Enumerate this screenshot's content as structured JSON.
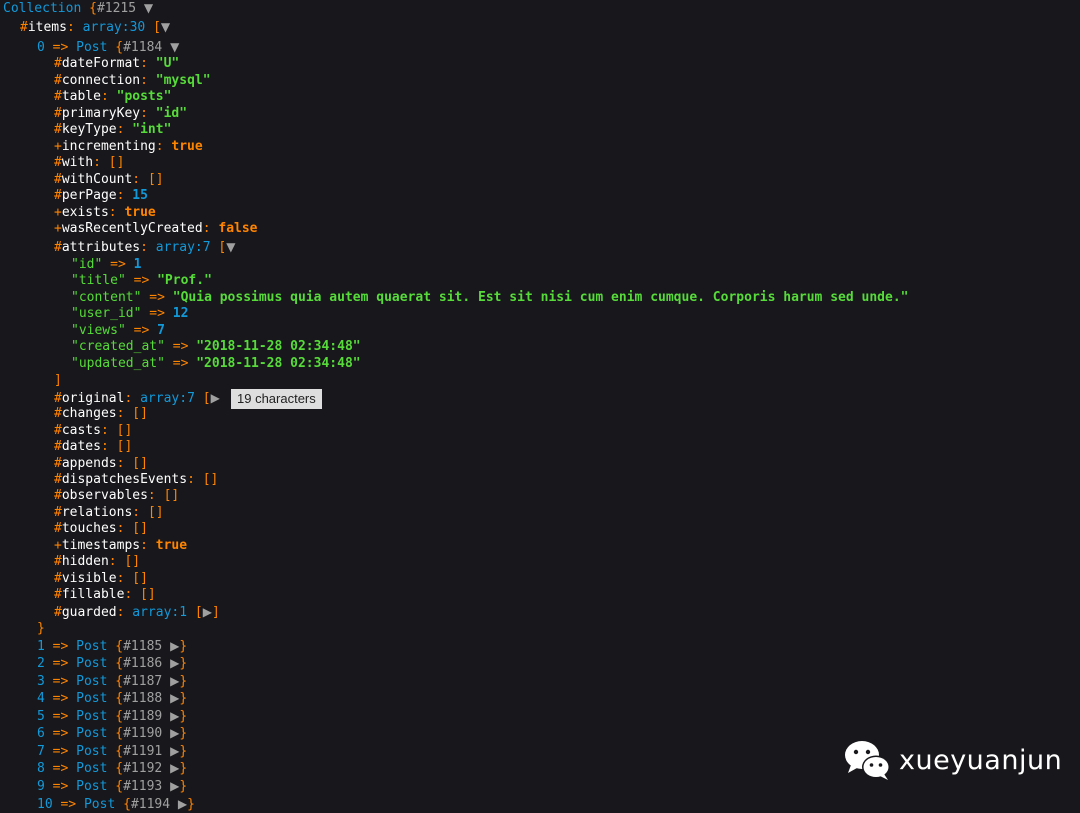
{
  "header": {
    "class_name": "Collection",
    "object_id": "{#1215",
    "collapse_glyph": "▼"
  },
  "items_line": {
    "name": "#items",
    "sep": ":",
    "type": "array:30",
    "bracket": "["
  },
  "post0": {
    "index": "0",
    "arrow": "=>",
    "class_name": "Post",
    "object_id": "{#1184"
  },
  "post0_props": [
    {
      "prefix": "#",
      "name": "dateFormat",
      "value": "\"U\"",
      "kind": "string"
    },
    {
      "prefix": "#",
      "name": "connection",
      "value": "\"mysql\"",
      "kind": "string"
    },
    {
      "prefix": "#",
      "name": "table",
      "value": "\"posts\"",
      "kind": "string"
    },
    {
      "prefix": "#",
      "name": "primaryKey",
      "value": "\"id\"",
      "kind": "string"
    },
    {
      "prefix": "#",
      "name": "keyType",
      "value": "\"int\"",
      "kind": "string"
    },
    {
      "prefix": "+",
      "name": "incrementing",
      "value": "true",
      "kind": "bool"
    },
    {
      "prefix": "#",
      "name": "with",
      "value": "[]",
      "kind": "bracket"
    },
    {
      "prefix": "#",
      "name": "withCount",
      "value": "[]",
      "kind": "bracket"
    },
    {
      "prefix": "#",
      "name": "perPage",
      "value": "15",
      "kind": "number"
    },
    {
      "prefix": "+",
      "name": "exists",
      "value": "true",
      "kind": "bool"
    },
    {
      "prefix": "+",
      "name": "wasRecentlyCreated",
      "value": "false",
      "kind": "bool"
    }
  ],
  "attributes": {
    "name": "#attributes",
    "type": "array:7",
    "bracket": "[",
    "close": "]",
    "entries": [
      {
        "key": "\"id\"",
        "value": "1",
        "kind": "number"
      },
      {
        "key": "\"title\"",
        "value": "\"Prof.\"",
        "kind": "string"
      },
      {
        "key": "\"content\"",
        "value": "\"Quia possimus quia autem quaerat sit. Est sit nisi cum enim cumque. Corporis harum sed unde.\"",
        "kind": "string"
      },
      {
        "key": "\"user_id\"",
        "value": "12",
        "kind": "number"
      },
      {
        "key": "\"views\"",
        "value": "7",
        "kind": "number"
      },
      {
        "key": "\"created_at\"",
        "value": "\"2018-11-28 02:34:48\"",
        "kind": "string"
      },
      {
        "key": "\"updated_at\"",
        "value": "\"2018-11-28 02:34:48\"",
        "kind": "string"
      }
    ]
  },
  "original": {
    "name": "#original",
    "type": "array:7",
    "bracket": "[",
    "tooltip": "19 characters"
  },
  "post0_props_after": [
    {
      "prefix": "#",
      "name": "changes",
      "value": "[]",
      "kind": "bracket"
    },
    {
      "prefix": "#",
      "name": "casts",
      "value": "[]",
      "kind": "bracket"
    },
    {
      "prefix": "#",
      "name": "dates",
      "value": "[]",
      "kind": "bracket"
    },
    {
      "prefix": "#",
      "name": "appends",
      "value": "[]",
      "kind": "bracket"
    },
    {
      "prefix": "#",
      "name": "dispatchesEvents",
      "value": "[]",
      "kind": "bracket"
    },
    {
      "prefix": "#",
      "name": "observables",
      "value": "[]",
      "kind": "bracket"
    },
    {
      "prefix": "#",
      "name": "relations",
      "value": "[]",
      "kind": "bracket"
    },
    {
      "prefix": "#",
      "name": "touches",
      "value": "[]",
      "kind": "bracket"
    },
    {
      "prefix": "+",
      "name": "timestamps",
      "value": "true",
      "kind": "bool"
    },
    {
      "prefix": "#",
      "name": "hidden",
      "value": "[]",
      "kind": "bracket"
    },
    {
      "prefix": "#",
      "name": "visible",
      "value": "[]",
      "kind": "bracket"
    },
    {
      "prefix": "#",
      "name": "fillable",
      "value": "[]",
      "kind": "bracket"
    }
  ],
  "guarded": {
    "name": "#guarded",
    "type": "array:1",
    "bracket": "[",
    "close": "]"
  },
  "post0_close": "}",
  "collapsed_posts": [
    {
      "index": "1",
      "object_id": "{#1185"
    },
    {
      "index": "2",
      "object_id": "{#1186"
    },
    {
      "index": "3",
      "object_id": "{#1187"
    },
    {
      "index": "4",
      "object_id": "{#1188"
    },
    {
      "index": "5",
      "object_id": "{#1189"
    },
    {
      "index": "6",
      "object_id": "{#1190"
    },
    {
      "index": "7",
      "object_id": "{#1191"
    },
    {
      "index": "8",
      "object_id": "{#1192"
    },
    {
      "index": "9",
      "object_id": "{#1193"
    },
    {
      "index": "10",
      "object_id": "{#1194"
    }
  ],
  "collapsed_post_class": "Post",
  "collapsed_close": "}",
  "expand_glyph": "▶",
  "watermark": {
    "text": "xueyuanjun",
    "icon": "wechat-icon"
  },
  "colors": {
    "background": "#18171b",
    "class": "#1299da",
    "key": "#ff8400",
    "string": "#56db3a",
    "number": "#1299da"
  }
}
